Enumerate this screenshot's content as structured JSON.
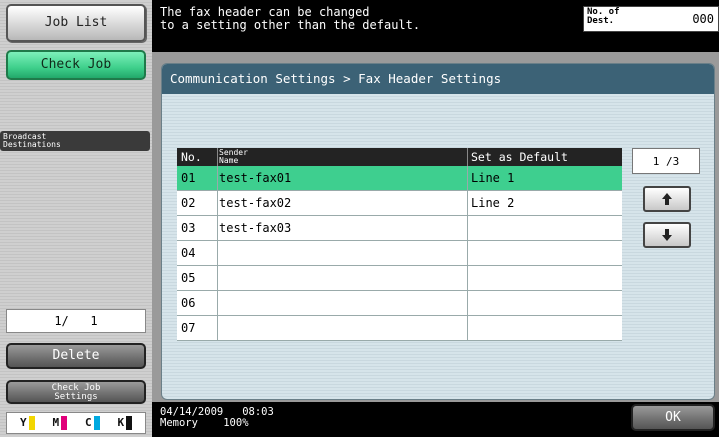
{
  "sidebar": {
    "job_list": "Job List",
    "check_job": "Check Job",
    "broadcast_heading": "Broadcast\nDestinations",
    "counter": "1/   1",
    "delete": "Delete",
    "check_job_settings": "Check Job\nSettings",
    "toner": [
      {
        "label": "Y",
        "color": "#f2d600"
      },
      {
        "label": "M",
        "color": "#e0007a"
      },
      {
        "label": "C",
        "color": "#00a9e0"
      },
      {
        "label": "K",
        "color": "#111111"
      }
    ]
  },
  "header": {
    "message_line1": "The fax header can be changed",
    "message_line2": "to a setting other than the default.",
    "dest_label": "No. of\nDest.",
    "dest_value": "000"
  },
  "panel": {
    "breadcrumb": "Communication Settings > Fax Header Settings"
  },
  "table": {
    "headers": {
      "no": "No.",
      "sender": "Sender\nName",
      "default": "Set as Default"
    },
    "rows": [
      {
        "no": "01",
        "sender": "test-fax01",
        "default": "Line 1",
        "selected": true
      },
      {
        "no": "02",
        "sender": "test-fax02",
        "default": "Line 2",
        "selected": false
      },
      {
        "no": "03",
        "sender": "test-fax03",
        "default": "",
        "selected": false
      },
      {
        "no": "04",
        "sender": "",
        "default": "",
        "selected": false
      },
      {
        "no": "05",
        "sender": "",
        "default": "",
        "selected": false
      },
      {
        "no": "06",
        "sender": "",
        "default": "",
        "selected": false
      },
      {
        "no": "07",
        "sender": "",
        "default": "",
        "selected": false
      }
    ]
  },
  "pager": {
    "page": "1 /3",
    "up_icon": "arrow-up-icon",
    "down_icon": "arrow-down-icon"
  },
  "status": {
    "date": "04/14/2009",
    "time": "08:03",
    "memory_label": "Memory",
    "memory_value": "100%"
  },
  "ok": "OK"
}
